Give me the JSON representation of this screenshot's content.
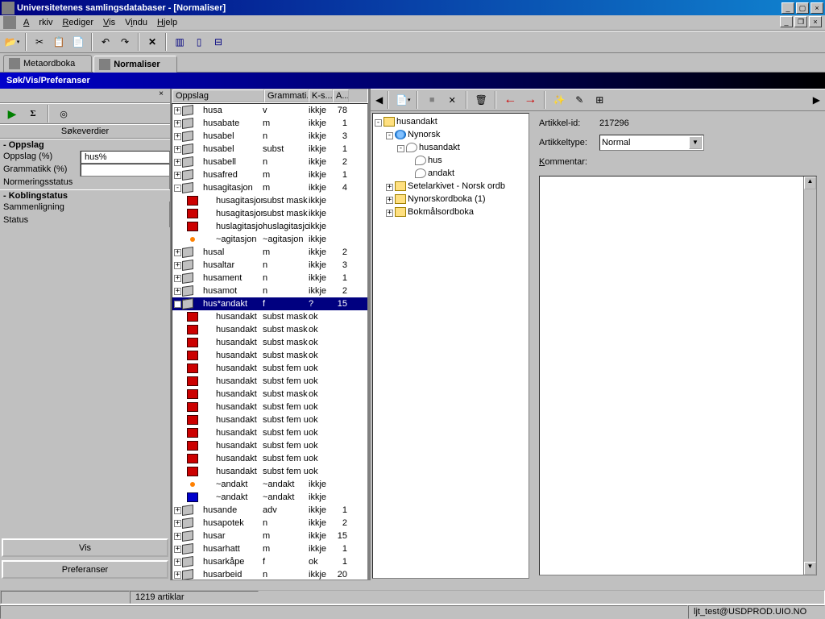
{
  "window": {
    "title": "Universitetenes samlingsdatabaser - [Normaliser]"
  },
  "menu": {
    "arkiv": "Arkiv",
    "rediger": "Rediger",
    "vis": "Vis",
    "vindu": "Vindu",
    "hjelp": "Hjelp"
  },
  "tabs": {
    "metaordboka": "Metaordboka",
    "normaliser": "Normaliser"
  },
  "banner": "Søk/Vis/Preferanser",
  "left": {
    "sokeverdier": "Søkeverdier",
    "oppslag_section": "- Oppslag",
    "oppslag_label": "Oppslag (%)",
    "oppslag_value": "hus%",
    "grammatikk_label": "Grammatikk (%)",
    "normering_label": "Normeringsstatus",
    "koblingstatus_section": "- Koblingstatus",
    "sammenligning": "Sammenligning",
    "status": "Status",
    "vis_btn": "Vis",
    "preferanser_btn": "Preferanser"
  },
  "grid": {
    "headers": {
      "c1": "Oppslag",
      "c2": "Grammati...",
      "c3": "K-s...",
      "c4": "A..."
    },
    "rows": [
      {
        "lvl": 0,
        "exp": "+",
        "icon": "green",
        "oppslag": "husa",
        "gram": "v",
        "ks": "ikkje",
        "a": "78"
      },
      {
        "lvl": 0,
        "exp": "+",
        "icon": "green",
        "oppslag": "husabate",
        "gram": "m",
        "ks": "ikkje",
        "a": "1"
      },
      {
        "lvl": 0,
        "exp": "+",
        "icon": "green",
        "oppslag": "husabel",
        "gram": "n",
        "ks": "ikkje",
        "a": "3"
      },
      {
        "lvl": 0,
        "exp": "+",
        "icon": "green",
        "oppslag": "husabel",
        "gram": "subst",
        "ks": "ikkje",
        "a": "1"
      },
      {
        "lvl": 0,
        "exp": "+",
        "icon": "green",
        "oppslag": "husabell",
        "gram": "n",
        "ks": "ikkje",
        "a": "2"
      },
      {
        "lvl": 0,
        "exp": "+",
        "icon": "green",
        "oppslag": "husafred",
        "gram": "m",
        "ks": "ikkje",
        "a": "1"
      },
      {
        "lvl": 0,
        "exp": "-",
        "icon": "green",
        "oppslag": "husagitasjon",
        "gram": "m",
        "ks": "ikkje",
        "a": "4"
      },
      {
        "lvl": 1,
        "icon": "red",
        "oppslag": "husagitasjon",
        "gram": "subst mask",
        "ks": "ikkje",
        "a": ""
      },
      {
        "lvl": 1,
        "icon": "red",
        "oppslag": "husagitasjon",
        "gram": "subst mask",
        "ks": "ikkje",
        "a": ""
      },
      {
        "lvl": 1,
        "icon": "red",
        "oppslag": "huslagitasjon",
        "gram": "huslagitasjon",
        "ks": "ikkje",
        "a": ""
      },
      {
        "lvl": 1,
        "icon": "ora",
        "oppslag": "~agitasjon",
        "gram": "~agitasjon",
        "ks": "ikkje",
        "a": ""
      },
      {
        "lvl": 0,
        "exp": "+",
        "icon": "green",
        "oppslag": "husal",
        "gram": "m",
        "ks": "ikkje",
        "a": "2"
      },
      {
        "lvl": 0,
        "exp": "+",
        "icon": "green",
        "oppslag": "husaltar",
        "gram": "n",
        "ks": "ikkje",
        "a": "3"
      },
      {
        "lvl": 0,
        "exp": "+",
        "icon": "green",
        "oppslag": "husament",
        "gram": "n",
        "ks": "ikkje",
        "a": "1"
      },
      {
        "lvl": 0,
        "exp": "+",
        "icon": "green",
        "oppslag": "husamot",
        "gram": "n",
        "ks": "ikkje",
        "a": "2"
      },
      {
        "lvl": 0,
        "exp": "-",
        "icon": "green",
        "oppslag": "hus*andakt",
        "gram": "f",
        "ks": "?",
        "a": "15",
        "sel": true
      },
      {
        "lvl": 1,
        "icon": "red",
        "oppslag": "husandakt",
        "gram": "subst mask",
        "ks": "ok",
        "a": ""
      },
      {
        "lvl": 1,
        "icon": "red",
        "oppslag": "husandakt",
        "gram": "subst mask",
        "ks": "ok",
        "a": ""
      },
      {
        "lvl": 1,
        "icon": "red",
        "oppslag": "husandakt",
        "gram": "subst mask",
        "ks": "ok",
        "a": ""
      },
      {
        "lvl": 1,
        "icon": "red",
        "oppslag": "husandakt",
        "gram": "subst mask",
        "ks": "ok",
        "a": ""
      },
      {
        "lvl": 1,
        "icon": "red",
        "oppslag": "husandakt",
        "gram": "subst fem ut",
        "ks": "ok",
        "a": ""
      },
      {
        "lvl": 1,
        "icon": "red",
        "oppslag": "husandakt",
        "gram": "subst fem ut",
        "ks": "ok",
        "a": ""
      },
      {
        "lvl": 1,
        "icon": "red",
        "oppslag": "husandakt",
        "gram": "subst mask",
        "ks": "ok",
        "a": ""
      },
      {
        "lvl": 1,
        "icon": "red",
        "oppslag": "husandakt",
        "gram": "subst fem ut",
        "ks": "ok",
        "a": ""
      },
      {
        "lvl": 1,
        "icon": "red",
        "oppslag": "husandakt",
        "gram": "subst fem ut",
        "ks": "ok",
        "a": ""
      },
      {
        "lvl": 1,
        "icon": "red",
        "oppslag": "husandakt",
        "gram": "subst fem ut",
        "ks": "ok",
        "a": ""
      },
      {
        "lvl": 1,
        "icon": "red",
        "oppslag": "husandakt",
        "gram": "subst fem ut",
        "ks": "ok",
        "a": ""
      },
      {
        "lvl": 1,
        "icon": "red",
        "oppslag": "husandakt",
        "gram": "subst fem ut",
        "ks": "ok",
        "a": ""
      },
      {
        "lvl": 1,
        "icon": "red",
        "oppslag": "husandakt",
        "gram": "subst fem ut",
        "ks": "ok",
        "a": ""
      },
      {
        "lvl": 1,
        "icon": "ora",
        "oppslag": "~andakt",
        "gram": "~andakt",
        "ks": "ikkje",
        "a": ""
      },
      {
        "lvl": 1,
        "icon": "blue",
        "oppslag": "~andakt",
        "gram": "~andakt",
        "ks": "ikkje",
        "a": ""
      },
      {
        "lvl": 0,
        "exp": "+",
        "icon": "green",
        "oppslag": "husande",
        "gram": "adv",
        "ks": "ikkje",
        "a": "1"
      },
      {
        "lvl": 0,
        "exp": "+",
        "icon": "green",
        "oppslag": "husapotek",
        "gram": "n",
        "ks": "ikkje",
        "a": "2"
      },
      {
        "lvl": 0,
        "exp": "+",
        "icon": "green",
        "oppslag": "husar",
        "gram": "m",
        "ks": "ikkje",
        "a": "15"
      },
      {
        "lvl": 0,
        "exp": "+",
        "icon": "green",
        "oppslag": "husarhatt",
        "gram": "m",
        "ks": "ikkje",
        "a": "1"
      },
      {
        "lvl": 0,
        "exp": "+",
        "icon": "green",
        "oppslag": "husarkåpe",
        "gram": "f",
        "ks": "ok",
        "a": "1"
      },
      {
        "lvl": 0,
        "exp": "+",
        "icon": "green",
        "oppslag": "husarbeid",
        "gram": "n",
        "ks": "ikkje",
        "a": "20"
      }
    ]
  },
  "tree": {
    "root": "husandakt",
    "nynorsk": "Nynorsk",
    "husandakt2": "husandakt",
    "hus": "hus",
    "andakt": "andakt",
    "setelarkivet": "Setelarkivet - Norsk ordb",
    "nynorskordboka": "Nynorskordboka (1)",
    "bokmalsordboka": "Bokmålsordboka"
  },
  "detail": {
    "artikkelid_lbl": "Artikkel-id:",
    "artikkelid_val": "217296",
    "artikkeltype_lbl": "Artikkeltype:",
    "artikkeltype_val": "Normal",
    "kommentar_lbl": "Kommentar:"
  },
  "status": {
    "count": "1219 artiklar",
    "user": "ljt_test@USDPROD.UIO.NO"
  }
}
